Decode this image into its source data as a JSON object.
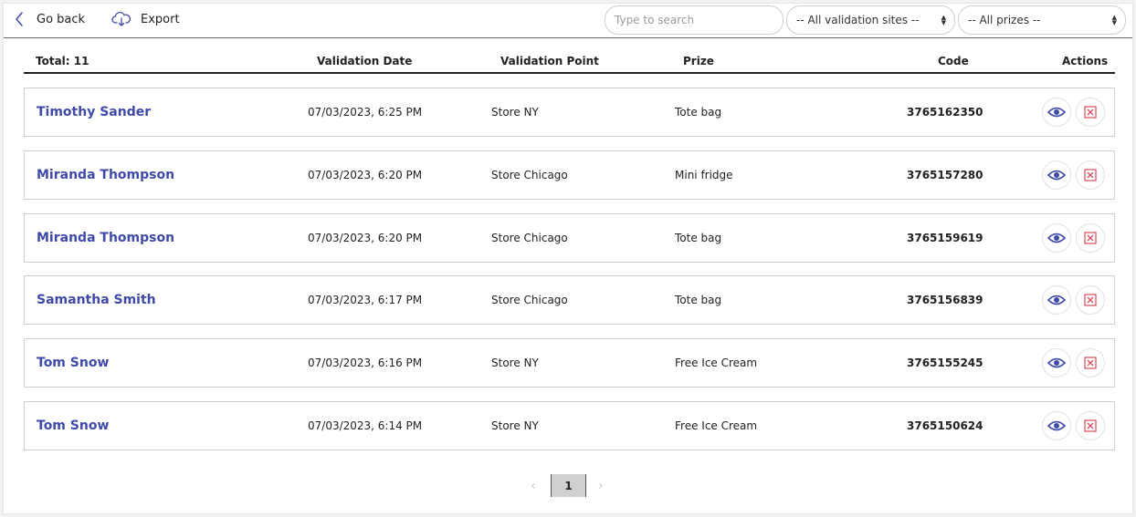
{
  "toolbar": {
    "back_label": "Go back",
    "export_label": "Export",
    "search_placeholder": "Type to search",
    "sites_select": "-- All validation sites --",
    "prizes_select": "-- All prizes --"
  },
  "table": {
    "total_label": "Total: 11",
    "headers": {
      "date": "Validation Date",
      "point": "Validation Point",
      "prize": "Prize",
      "code": "Code",
      "actions": "Actions"
    },
    "rows": [
      {
        "name": "Timothy Sander",
        "date": "07/03/2023, 6:25 PM",
        "point": "Store NY",
        "prize": "Tote bag",
        "code": "3765162350"
      },
      {
        "name": "Miranda Thompson",
        "date": "07/03/2023, 6:20 PM",
        "point": "Store Chicago",
        "prize": "Mini fridge",
        "code": "3765157280"
      },
      {
        "name": "Miranda Thompson",
        "date": "07/03/2023, 6:20 PM",
        "point": "Store Chicago",
        "prize": "Tote bag",
        "code": "3765159619"
      },
      {
        "name": "Samantha Smith",
        "date": "07/03/2023, 6:17 PM",
        "point": "Store Chicago",
        "prize": "Tote bag",
        "code": "3765156839"
      },
      {
        "name": "Tom Snow",
        "date": "07/03/2023, 6:16 PM",
        "point": "Store NY",
        "prize": "Free Ice Cream",
        "code": "3765155245"
      },
      {
        "name": "Tom Snow",
        "date": "07/03/2023, 6:14 PM",
        "point": "Store NY",
        "prize": "Free Ice Cream",
        "code": "3765150624"
      }
    ]
  },
  "pagination": {
    "current_page": "1",
    "prev_icon": "chevron-left-icon",
    "next_icon": "chevron-right-icon"
  },
  "icons": {
    "back": "chevron-left-icon",
    "export": "cloud-download-icon",
    "view": "eye-icon",
    "delete": "close-square-icon"
  },
  "colors": {
    "name_link": "#3f4aa8",
    "view_icon": "#3f4aa8",
    "delete_icon": "#d94a5a",
    "page_active_bg": "#d0d0d0"
  }
}
